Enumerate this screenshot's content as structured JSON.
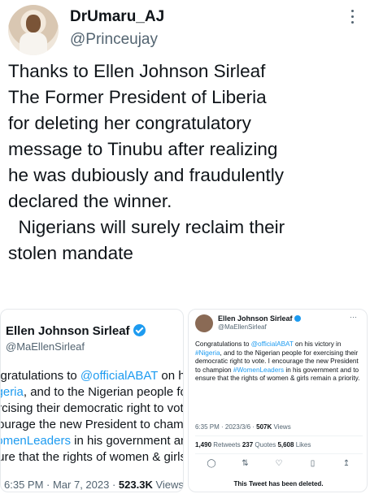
{
  "author": {
    "name": "DrUmaru_AJ",
    "handle": "@Princeujay"
  },
  "tweet": {
    "text": "Thanks to Ellen Johnson Sirleaf\nThe Former President of Liberia\nfor deleting her congratulatory\nmessage to Tinubu after realizing\nhe was dubiously and fraudulently\ndeclared the winner.\n  Nigerians will surely reclaim their\nstolen mandate"
  },
  "left_screenshot": {
    "name": "Ellen Johnson Sirleaf",
    "handle": "@MaEllenSirleaf",
    "lines": [
      {
        "pre": "Congratulations to ",
        "link": "@officialABAT",
        "post": " on his v"
      },
      {
        "pre": "",
        "link": "#Nigeria",
        "post": ", and to the Nigerian people fo"
      },
      {
        "pre": "exercising their democratic right to vote. I",
        "link": "",
        "post": ""
      },
      {
        "pre": "encourage the new President to champio",
        "link": "",
        "post": ""
      },
      {
        "pre": "",
        "link": "#WomenLeaders",
        "post": " in his government and t"
      },
      {
        "pre": "ensure that the rights of women & girls re",
        "link": "",
        "post": ""
      }
    ],
    "date": "6:35 PM · Mar 7, 2023 · ",
    "views_count": "523.3K",
    "views_label": " Views"
  },
  "right_screenshot": {
    "name": "Ellen Johnson Sirleaf",
    "handle": "@MaEllenSirleaf",
    "more": "···",
    "body_parts": [
      {
        "text": "Congratulations to ",
        "link": false
      },
      {
        "text": "@officialABAT",
        "link": true
      },
      {
        "text": " on his victory in ",
        "link": false
      },
      {
        "text": "#Nigeria",
        "link": true
      },
      {
        "text": ", and to the Nigerian people for exercising their democratic right to vote. I encourage the new President to champion ",
        "link": false
      },
      {
        "text": "#WomenLeaders",
        "link": true
      },
      {
        "text": " in his government and to ensure that the rights of women & girls remain a priority.",
        "link": false
      }
    ],
    "time": "6:35 PM · 2023/3/6 · ",
    "views_count": "507K",
    "views_label": " Views",
    "retweets_count": "1,490",
    "retweets_label": " Retweets  ",
    "quotes_count": "237",
    "quotes_label": " Quotes  ",
    "likes_count": "5,608",
    "likes_label": " Likes",
    "actions": [
      "reply-icon",
      "retweet-icon",
      "like-icon",
      "bookmark-icon",
      "share-icon"
    ],
    "deleted_notice": "This Tweet has been deleted."
  }
}
